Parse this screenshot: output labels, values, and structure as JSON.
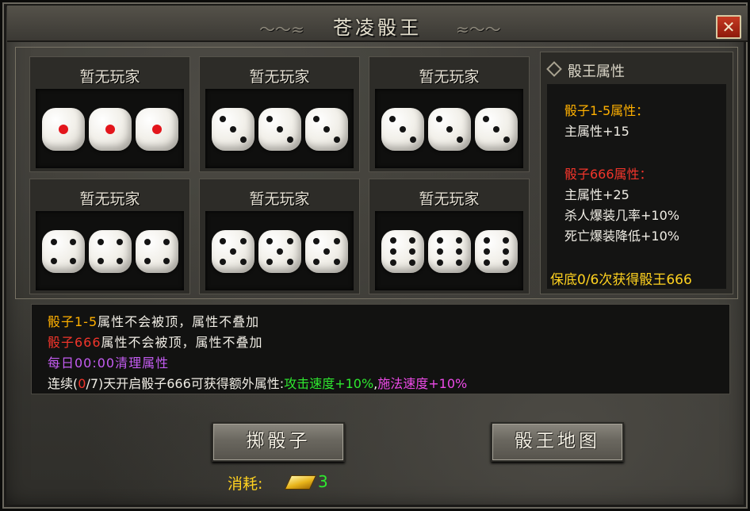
{
  "window": {
    "title": "苍凌骰王",
    "close_symbol": "✕"
  },
  "slots": [
    {
      "player": "暂无玩家",
      "face": 1
    },
    {
      "player": "暂无玩家",
      "face": 3
    },
    {
      "player": "暂无玩家",
      "face": 3
    },
    {
      "player": "暂无玩家",
      "face": 4
    },
    {
      "player": "暂无玩家",
      "face": 5
    },
    {
      "player": "暂无玩家",
      "face": 6
    }
  ],
  "attributes": {
    "header": "骰王属性",
    "g1_title": "骰子1-5属性：",
    "g1_line1": "主属性+15",
    "g2_title": "骰子666属性：",
    "g2_line1": "主属性+25",
    "g2_line2": "杀人爆装几率+10%",
    "g2_line3": "死亡爆装降低+10%",
    "guarantee": "保底0/6次获得骰王666"
  },
  "info": {
    "l1_a": "骰子1-5",
    "l1_b": "属性不会被顶，属性不叠加",
    "l2_a": "骰子666",
    "l2_b": "属性不会被顶，属性不叠加",
    "l3": "每日00:00清理属性",
    "l4_a": "连续(",
    "l4_b": "0",
    "l4_c": "/7)天开启骰子666可获得额外属性:",
    "l4_d": "攻击速度+10%",
    "l4_e": ",",
    "l4_f": "施法速度+10%"
  },
  "buttons": {
    "roll": "掷骰子",
    "map": "骰王地图"
  },
  "cost": {
    "label": "消耗:",
    "value": "3",
    "icon": "gold-ingot-icon"
  }
}
